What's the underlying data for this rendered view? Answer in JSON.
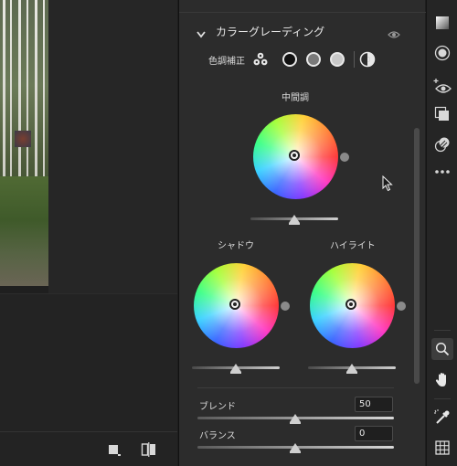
{
  "section": {
    "title": "カラーグレーディング",
    "icon_collapse": "chevron-down-icon",
    "icon_visibility": "eye-icon"
  },
  "adjust_mode": {
    "label": "色調補正",
    "options": [
      "three-way-icon",
      "shadows-icon",
      "midtones-icon",
      "highlights-icon",
      "global-icon"
    ]
  },
  "wheels": {
    "midtones": {
      "label": "中間調",
      "hue": 0,
      "saturation": 0,
      "luminance": 0
    },
    "shadows": {
      "label": "シャドウ",
      "hue": 0,
      "saturation": 0,
      "luminance": 0
    },
    "highlights": {
      "label": "ハイライト",
      "hue": 0,
      "saturation": 0,
      "luminance": 0
    }
  },
  "blend": {
    "label": "ブレンド",
    "value": "50",
    "level": 0.5
  },
  "balance": {
    "label": "バランス",
    "value": "0",
    "level": 0.5
  },
  "toolbar": {
    "tools": [
      "histogram-icon",
      "mask-icon",
      "redeye-icon",
      "layers-icon",
      "presets-icon",
      "more-icon",
      "zoom-icon",
      "hand-icon",
      "color-sampler-icon",
      "grid-icon"
    ],
    "active": "zoom-icon"
  },
  "canvas_footer": {
    "icons": [
      "crop-view-icon",
      "before-after-icon"
    ]
  },
  "colors": {
    "panel_bg": "#2c2c2c",
    "app_bg": "#1e1e1e",
    "text": "#dcdcdc"
  }
}
